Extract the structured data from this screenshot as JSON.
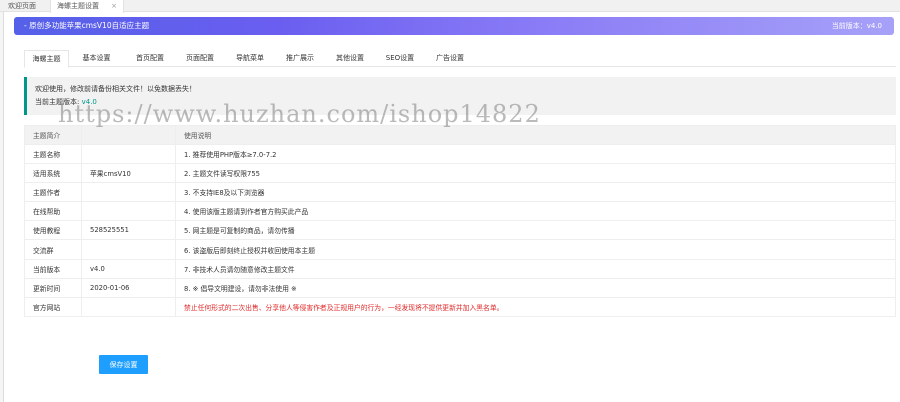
{
  "top_tabs": [
    {
      "label": "欢迎页面"
    },
    {
      "label": "海螺主题设置",
      "close": "×"
    }
  ],
  "banner": {
    "left": "- 原创多功能苹果cmsV10自适应主题",
    "right": "当前版本：v4.0"
  },
  "nav_tabs": [
    {
      "label": "海螺主题"
    },
    {
      "label": "基本设置"
    },
    {
      "label": "首页配置"
    },
    {
      "label": "页面配置"
    },
    {
      "label": "导航菜单"
    },
    {
      "label": "推广展示"
    },
    {
      "label": "其他设置"
    },
    {
      "label": "SEO设置"
    },
    {
      "label": "广告设置"
    }
  ],
  "notice": {
    "line1": "欢迎使用，修改前请备份相关文件！以免数据丢失！",
    "line2_label": "当前主题版本:",
    "line2_version": "v4.0"
  },
  "watermark": "https://www.huzhan.com/ishop14822",
  "table": {
    "headers": [
      "主题简介",
      "",
      "使用说明"
    ],
    "rows": [
      [
        "主题名称",
        "",
        "1. 推荐使用PHP版本≥7.0-7.2"
      ],
      [
        "适用系统",
        "苹果cmsV10",
        "2. 主题文件读写权限755"
      ],
      [
        "主题作者",
        "",
        "3. 不支持IE8及以下浏览器"
      ],
      [
        "在线帮助",
        "",
        "4. 使用该版主题请到作者官方购买此产品"
      ],
      [
        "使用教程",
        "528525551",
        "5. 网主题是可复制的商品，请勿传播"
      ],
      [
        "交流群",
        "",
        "6. 该盗版后即刻终止授权并收回使用本主题"
      ],
      [
        "当前版本",
        "v4.0",
        "7. 非技术人员请勿随意修改主题文件"
      ],
      [
        "更新时间",
        "2020-01-06",
        "8. ※ 倡导文明建设，请勿非法使用 ※"
      ],
      [
        "官方网站",
        "",
        "禁止任何形式的二次出售、分享他人等侵害作者及正规用户的行为，一经发现将不提供更新并加入黑名单。"
      ]
    ]
  },
  "save_button": "保存设置",
  "colors": {
    "accent": "#009688",
    "button": "#1e9fff",
    "warning": "#e02a2a",
    "banner_start": "#5560e8",
    "banner_end": "#a7a1f8"
  }
}
